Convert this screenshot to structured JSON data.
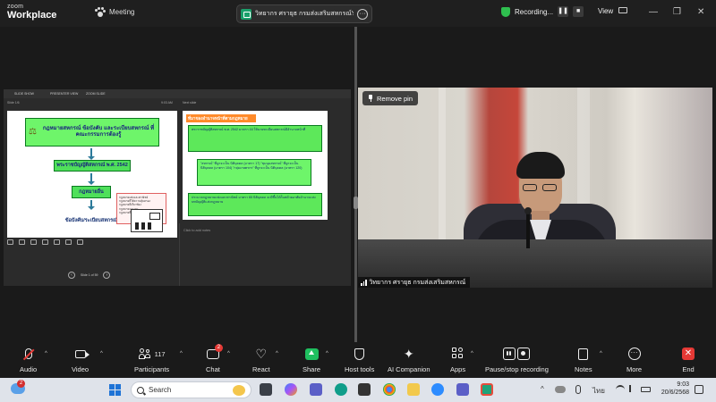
{
  "titlebar": {
    "logo_top": "zoom",
    "logo_bottom": "Workplace",
    "meeting_tab": "Meeting",
    "share_title": "วิทยากร ศรายุธ กรมส่งเสริมสหกรณ์'s s",
    "recording_label": "Recording...",
    "view_label": "View",
    "pause_glyph": "❚❚",
    "stop_glyph": "■",
    "more_glyph": "···",
    "minimize_glyph": "—",
    "maximize_glyph": "❐",
    "close_glyph": "✕"
  },
  "shared_screen": {
    "top_tabs": [
      "SLIDE SHOW",
      "PRESENTER VIEW",
      "ZOOM SLIDE"
    ],
    "pane_left": "Slide 1/6",
    "pane_time": "9:03 AM",
    "pane_right": "Next slide",
    "slide_counter": "Slide 1 of 59",
    "notes_placeholder": "Click to add notes",
    "slide1": {
      "title": "กฎหมายสหกรณ์ ข้อบังคับ และระเบียบสหกรณ์ ที่คณะกรรมการต้องรู้",
      "box_act": "พระราชบัญญัติสหกรณ์ พ.ศ. 2542",
      "box_sub_law": "กฎหมายอื่น",
      "box_rules": "ข้อบังคับ/ระเบียบสหกรณ์",
      "notes": [
        "กฎหมายแพ่งและพาณิชย์",
        "กฎหมายที่ให้ความคุ้มครอง",
        "กฎหมายที่เกี่ยวข้อง",
        "กฎหมายแรงงาน",
        "กฎหมายที่ให้ความคุ้มครอง"
      ]
    },
    "slide2": {
      "title": "ที่มาของอำนาจหน้าที่ตามกฎหมาย",
      "block1": "พระราชบัญญัติสหกรณ์ พ.ศ. 2542 มาตรา 16 ให้นายทะเบียนสหกรณ์มีอำนาจหน้าที่",
      "block2": "\"สหกรณ์\" ที่ถูกจะเป็น นิติบุคคล (มาตรา 17) \"ชุมนุมสหกรณ์\" ที่ถูกจะเป็น นิติบุคคล (มาตรา 104) \"กลุ่มเกษตรกร\" ที่ถูกจะเป็น นิติบุคคล (มาตรา 120)",
      "block3": "ประมวลกฎหมายแพ่งและพาณิชย์ มาตรา 65 นิติบุคคล จะมีขึ้นได้ก็แต่ด้วยอาศัยอำนาจแห่งบทบัญญัติแห่งกฎหมาย"
    }
  },
  "camera": {
    "remove_pin": "Remove pin",
    "participant_name": "วิทยากร ศรายุธ กรมส่งเสริมสหกรณ์"
  },
  "toolbar": {
    "audio": "Audio",
    "video": "Video",
    "participants": "Participants",
    "participants_count": "117",
    "chat": "Chat",
    "chat_badge": "2",
    "react": "React",
    "share": "Share",
    "host_tools": "Host tools",
    "ai_companion": "AI Companion",
    "apps": "Apps",
    "record": "Pause/stop recording",
    "notes": "Notes",
    "more": "More",
    "end": "End",
    "more_glyph": "···",
    "end_glyph": "✕",
    "caret_glyph": "^"
  },
  "taskbar": {
    "search_placeholder": "Search",
    "weather_badge": "2",
    "tray_caret": "^",
    "language": "ไทย",
    "time": "9:03",
    "date": "20/6/2568"
  },
  "colors": {
    "share_green": "#1fbf5f",
    "end_red": "#e53935",
    "slide_green": "#4fe05a",
    "slide_orange": "#ff8a2a"
  }
}
